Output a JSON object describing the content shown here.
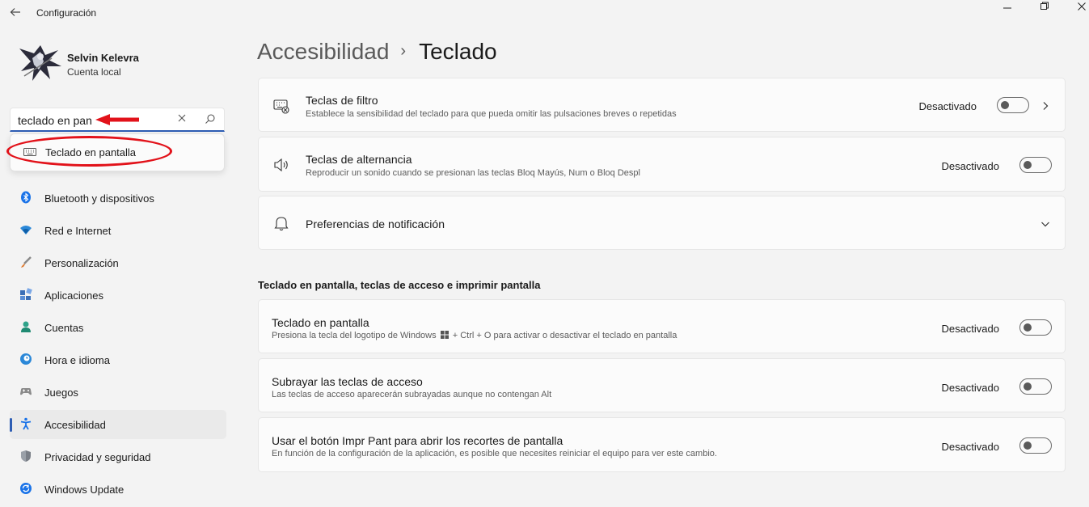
{
  "window": {
    "title": "Configuración",
    "back_icon": "arrow-left-icon",
    "controls": [
      "minimize-icon",
      "maximize-icon",
      "close-icon"
    ]
  },
  "user": {
    "name": "Selvin Kelevra",
    "account_type": "Cuenta local"
  },
  "search": {
    "value": "teclado en pan",
    "clear_icon": "close-icon",
    "search_icon": "search-icon",
    "annotation_color": "#e2121a"
  },
  "search_results": [
    {
      "label": "Teclado en pantalla",
      "icon": "keyboard-icon"
    }
  ],
  "sidebar": {
    "items": [
      {
        "label": "Bluetooth y dispositivos",
        "icon": "bluetooth-icon"
      },
      {
        "label": "Red e Internet",
        "icon": "wifi-icon"
      },
      {
        "label": "Personalización",
        "icon": "brush-icon"
      },
      {
        "label": "Aplicaciones",
        "icon": "apps-icon"
      },
      {
        "label": "Cuentas",
        "icon": "person-icon"
      },
      {
        "label": "Hora e idioma",
        "icon": "globe-clock-icon"
      },
      {
        "label": "Juegos",
        "icon": "gamepad-icon"
      },
      {
        "label": "Accesibilidad",
        "icon": "accessibility-icon",
        "active": true
      },
      {
        "label": "Privacidad y seguridad",
        "icon": "shield-icon"
      },
      {
        "label": "Windows Update",
        "icon": "update-icon"
      }
    ]
  },
  "breadcrumb": {
    "parent": "Accesibilidad",
    "separator": "›",
    "current": "Teclado"
  },
  "cards_top": [
    {
      "title": "Teclas de filtro",
      "description": "Establece la sensibilidad del teclado para que pueda omitir las pulsaciones breves o repetidas",
      "state": "Desactivado",
      "icon": "filter-keys-icon",
      "on": false
    },
    {
      "title": "Teclas de alternancia",
      "description": "Reproducir un sonido cuando se presionan las teclas Bloq Mayús, Num o Bloq Despl",
      "state": "Desactivado",
      "icon": "speaker-icon",
      "on": false
    },
    {
      "title": "Preferencias de notificación",
      "icon": "bell-icon"
    }
  ],
  "section_title": "Teclado en pantalla, teclas de acceso e imprimir pantalla",
  "cards_bottom": [
    {
      "title": "Teclado en pantalla",
      "description_before": "Presiona la tecla del logotipo de Windows",
      "description_after": "+ Ctrl + O para activar o desactivar el teclado en pantalla",
      "state": "Desactivado",
      "on": false
    },
    {
      "title": "Subrayar las teclas de acceso",
      "description": "Las teclas de acceso aparecerán subrayadas aunque no contengan Alt",
      "state": "Desactivado",
      "on": false
    },
    {
      "title": "Usar el botón Impr Pant para abrir los recortes de pantalla",
      "description": "En función de la configuración de la aplicación, es posible que necesites reiniciar el equipo para ver este cambio.",
      "state": "Desactivado",
      "on": false
    }
  ],
  "colors": {
    "accent": "#2d5db3",
    "background": "#f3f3f3",
    "card": "#fbfbfb"
  }
}
